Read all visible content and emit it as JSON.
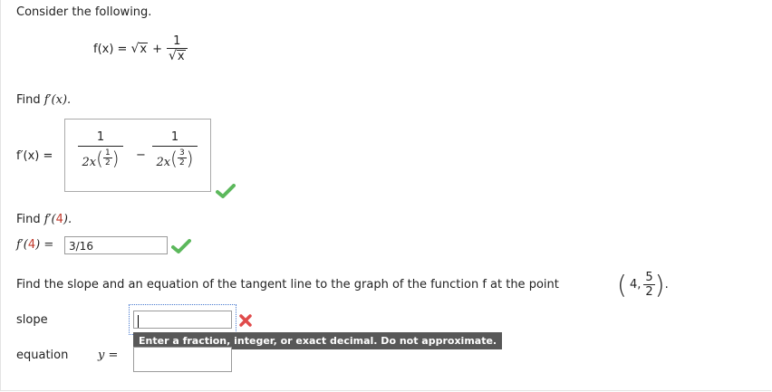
{
  "intro": "Consider the following.",
  "function_def": {
    "lhs": "f(x) = ",
    "sqrt_arg": "x",
    "plus": "+",
    "frac_num": "1",
    "frac_den_arg": "x"
  },
  "part1": {
    "prompt_label": "Find",
    "prompt_func": "f′(x).",
    "answer_label": "f′(x) =",
    "term1": {
      "num": "1",
      "den_base": "2x",
      "exp_num": "1",
      "exp_den": "2"
    },
    "minus": "−",
    "term2": {
      "num": "1",
      "den_base": "2x",
      "exp_num": "3",
      "exp_den": "2"
    }
  },
  "part2": {
    "prompt_label": "Find",
    "prompt_func": "f′(",
    "prompt_arg": "4",
    "prompt_close": ").",
    "answer_label_func": "f′(",
    "answer_label_arg": "4",
    "answer_label_close": ") =",
    "answer_value": "3/16"
  },
  "part3": {
    "prompt": "Find the slope and an equation of the tangent line to the graph of the function f at the point",
    "point_x": "4,",
    "point_num": "5",
    "point_den": "2",
    "slope_label": "slope",
    "slope_value": "",
    "tooltip": "Enter a fraction, integer, or exact decimal. Do not approximate.",
    "equation_label": "equation",
    "equation_lhs": "y =",
    "equation_value": ""
  },
  "colors": {
    "check_green": "#5cb85c",
    "cross_red": "#e04b4b",
    "tooltip_bg": "#585858",
    "red_text": "#c0392b"
  },
  "icons": [
    "check-icon",
    "check-icon",
    "cross-icon"
  ]
}
